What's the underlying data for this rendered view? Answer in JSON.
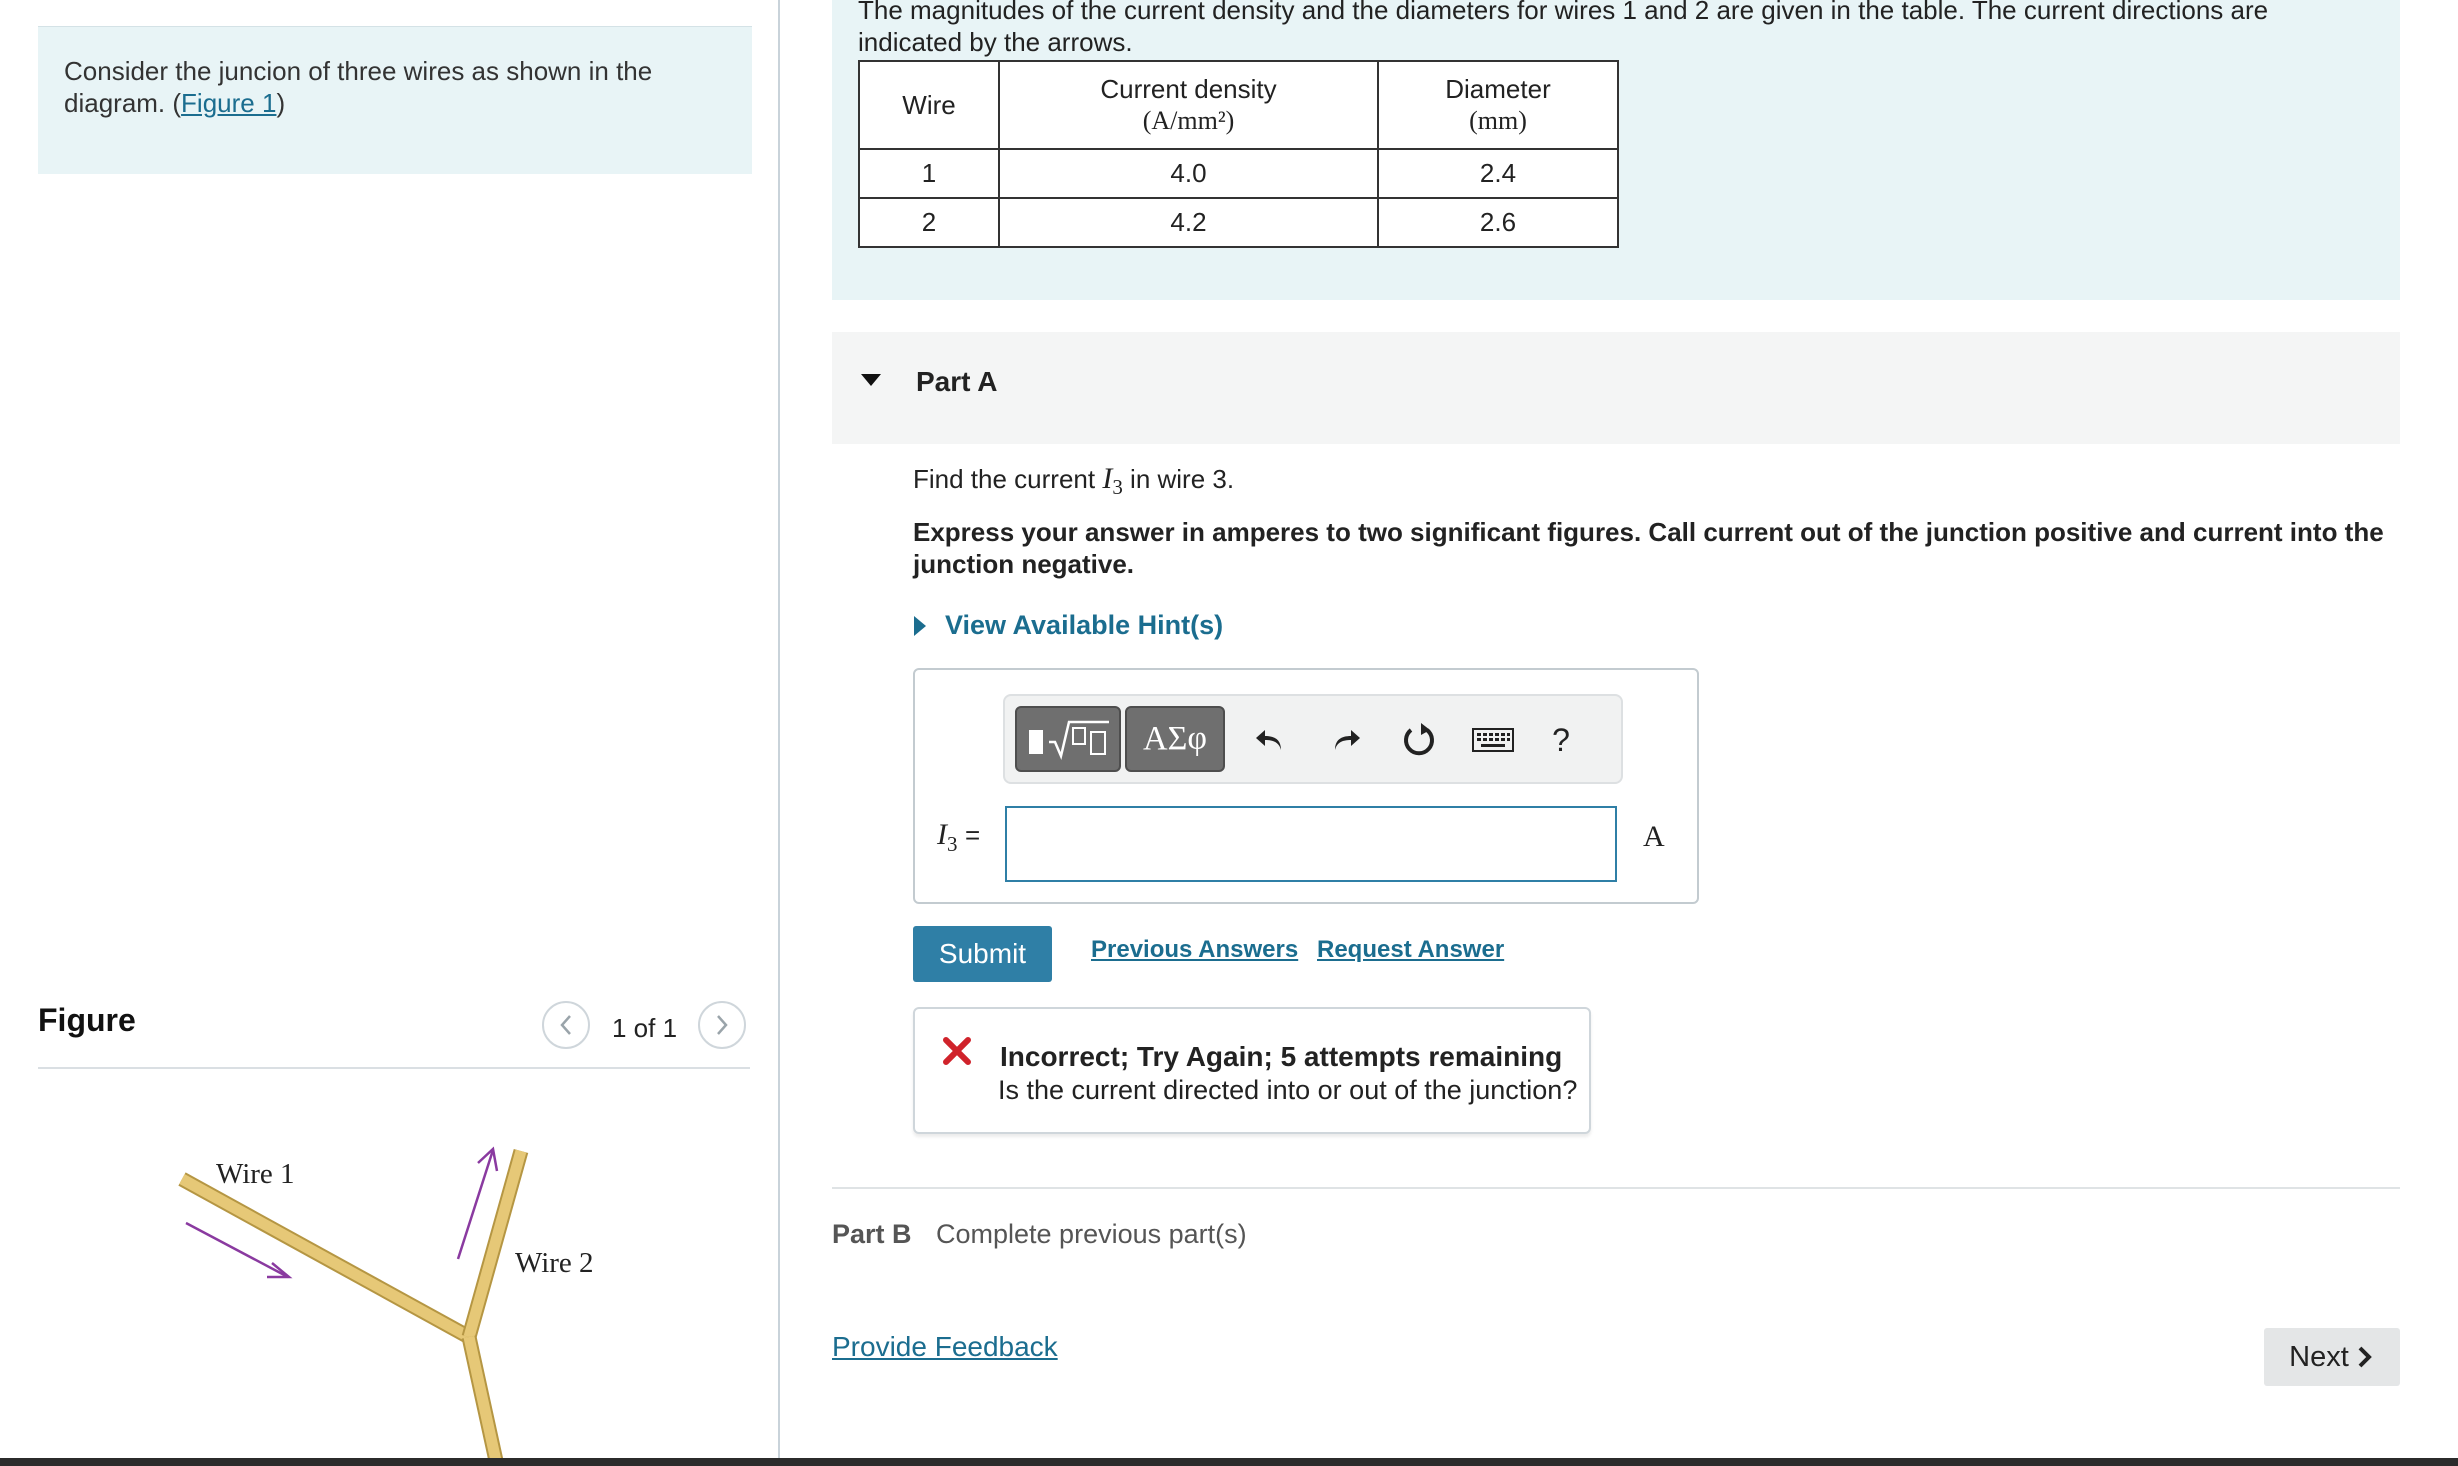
{
  "intro": {
    "text": "Consider the juncion of three wires as shown in the diagram. (",
    "link": "Figure 1",
    "text_end": ")"
  },
  "figure": {
    "title": "Figure",
    "pager": "1 of 1",
    "prev_icon": "chevron-left-icon",
    "next_icon": "chevron-right-icon",
    "wire1_label": "Wire 1",
    "wire2_label": "Wire 2",
    "wire_color": "#e6c877",
    "arrow_color": "#8a3aa0"
  },
  "problem": {
    "text": "The magnitudes of the current density and the diameters for wires 1 and 2 are given in the table. The current directions are indicated by the arrows.",
    "table": {
      "headers": {
        "wire": "Wire",
        "density": "Current density",
        "density_unit": "(A/mm²)",
        "diameter": "Diameter",
        "diameter_unit": "(mm)"
      },
      "rows": [
        {
          "wire": "1",
          "density": "4.0",
          "diameter": "2.4"
        },
        {
          "wire": "2",
          "density": "4.2",
          "diameter": "2.6"
        }
      ]
    }
  },
  "partA": {
    "label": "Part A",
    "question_pre": "Find the current ",
    "question_var": "I",
    "question_sub": "3",
    "question_post": " in wire 3.",
    "instructions": "Express your answer in amperes to two significant figures. Call current out of the junction positive and current into the junction negative.",
    "hints": "View Available Hint(s)",
    "toolbar": {
      "templates_icon": "templates-sqrt-icon",
      "greek_label": "ΑΣφ",
      "undo_icon": "undo-icon",
      "redo_icon": "redo-icon",
      "reset_icon": "reset-icon",
      "keyboard_icon": "keyboard-icon",
      "help_label": "?"
    },
    "input": {
      "var": "I",
      "sub": "3",
      "equals": "=",
      "value": "",
      "unit": "A"
    },
    "submit": "Submit",
    "previous_answers": "Previous Answers",
    "request_answer": "Request Answer",
    "feedback": {
      "title": "Incorrect; Try Again; 5 attempts remaining",
      "message": "Is the current directed into or out of the junction?",
      "icon": "x-icon",
      "icon_color": "#d0232b"
    }
  },
  "partB": {
    "label": "Part B",
    "status": "Complete previous part(s)"
  },
  "footer": {
    "provide_feedback": "Provide Feedback",
    "next": "Next"
  },
  "colors": {
    "accent": "#2f7fa6",
    "link": "#1b6d8f",
    "panel_bg": "#e8f4f6"
  }
}
